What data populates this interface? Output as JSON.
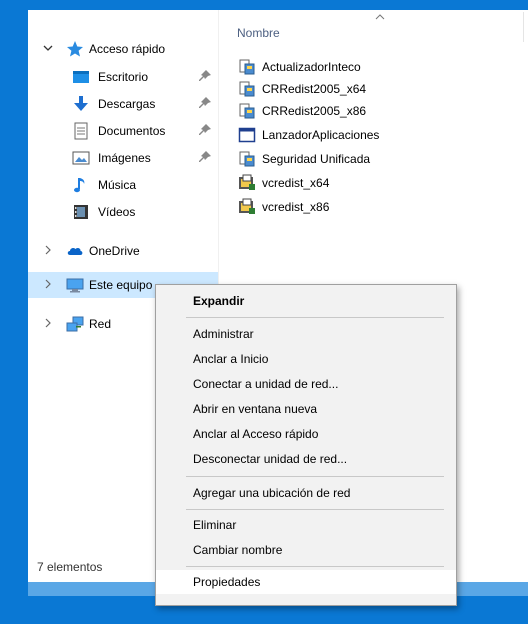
{
  "list_header": {
    "name_column": "Nombre"
  },
  "nav": {
    "quick_access": "Acceso rápido",
    "items": [
      {
        "label": "Escritorio",
        "icon": "desktop-folder-icon",
        "pinned": true
      },
      {
        "label": "Descargas",
        "icon": "download-icon",
        "pinned": true
      },
      {
        "label": "Documentos",
        "icon": "documents-icon",
        "pinned": true
      },
      {
        "label": "Imágenes",
        "icon": "pictures-icon",
        "pinned": true
      },
      {
        "label": "Música",
        "icon": "music-icon",
        "pinned": false
      },
      {
        "label": "Vídeos",
        "icon": "videos-icon",
        "pinned": false
      }
    ],
    "onedrive": "OneDrive",
    "this_pc": "Este equipo",
    "network": "Red"
  },
  "files": [
    {
      "name": "ActualizadorInteco",
      "icon": "installer-icon"
    },
    {
      "name": "CRRedist2005_x64",
      "icon": "installer-icon"
    },
    {
      "name": "CRRedist2005_x86",
      "icon": "installer-icon"
    },
    {
      "name": "LanzadorAplicaciones",
      "icon": "window-icon"
    },
    {
      "name": "Seguridad Unificada",
      "icon": "installer-icon"
    },
    {
      "name": "vcredist_x64",
      "icon": "setup-package-icon"
    },
    {
      "name": "vcredist_x86",
      "icon": "setup-package-icon"
    }
  ],
  "status": {
    "count": "7 elementos"
  },
  "context_menu": {
    "expand": "Expandir",
    "items_group1": [
      "Administrar",
      "Anclar a Inicio",
      "Conectar a unidad de red...",
      "Abrir en ventana nueva",
      "Anclar al Acceso rápido",
      "Desconectar unidad de red..."
    ],
    "add_network_location": "Agregar una ubicación de red",
    "delete": "Eliminar",
    "rename": "Cambiar nombre",
    "properties": "Propiedades"
  },
  "colors": {
    "desktop": "#0a78d4",
    "selection": "#cce8ff",
    "menu_bg": "#f2f2f2"
  }
}
